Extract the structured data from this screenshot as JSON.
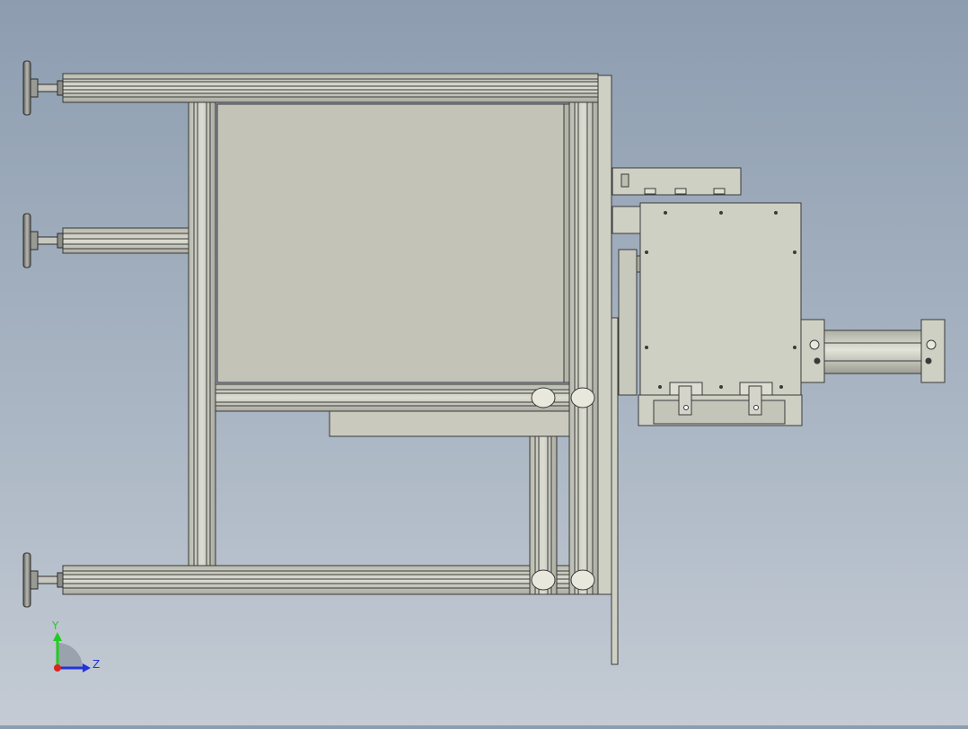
{
  "viewport": {
    "background_top": "#8d9db0",
    "background_bottom": "#c4cbd4"
  },
  "triad": {
    "y_label": "Y",
    "z_label": "Z",
    "y_color": "#22cc22",
    "z_color": "#2233dd",
    "origin_color": "#dd2222"
  },
  "model": {
    "profile_color": "#c8c9bc",
    "profile_edge": "#3a3a3a",
    "panel_color": "#c3c3b8",
    "plate_color": "#cfd0c4",
    "leveling_feet_count": 3
  }
}
